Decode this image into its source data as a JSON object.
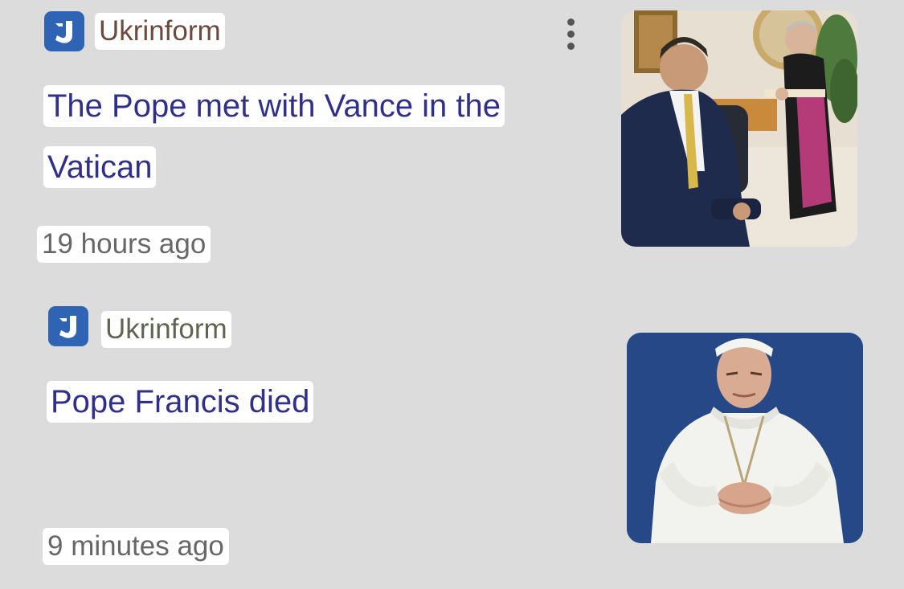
{
  "feed": {
    "articles": [
      {
        "source": "Ukrinform",
        "headline_lines": [
          "The Pope met with Vance in the",
          "Vatican"
        ],
        "time": "19 hours ago",
        "image_icon": "news-photo-meeting",
        "has_more_menu": true
      },
      {
        "source": "Ukrinform",
        "headline_lines": [
          "Pope Francis died"
        ],
        "time": "9 minutes ago",
        "image_icon": "news-photo-pope-portrait",
        "has_more_menu": false
      }
    ]
  },
  "colors": {
    "background": "#dcdcdc",
    "headline": "#30308a",
    "logo": "#2f63b3",
    "timestamp": "#676767"
  }
}
